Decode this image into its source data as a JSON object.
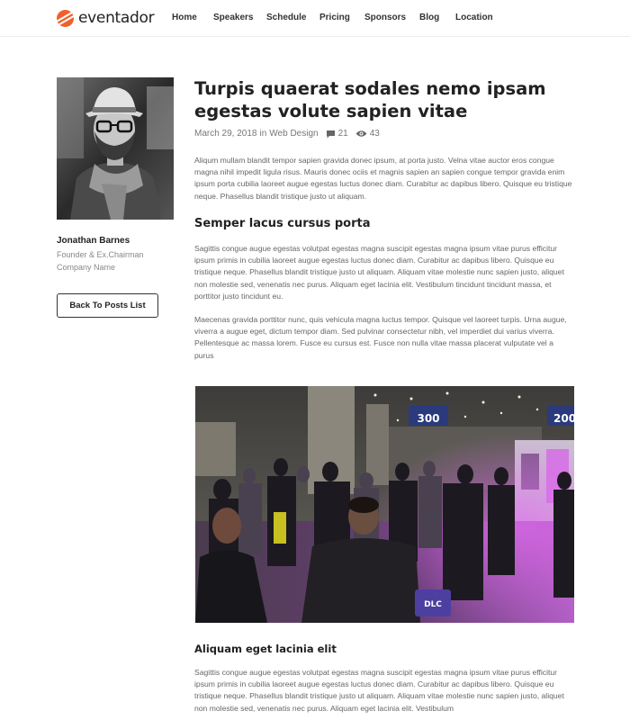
{
  "brand": {
    "name": "eventador",
    "accent": "#f0602b"
  },
  "nav": {
    "items": [
      {
        "label": "Home"
      },
      {
        "label": "Speakers"
      },
      {
        "label": "Schedule"
      },
      {
        "label": "Pricing"
      },
      {
        "label": "Sponsors"
      },
      {
        "label": "Blog"
      },
      {
        "label": "Location"
      }
    ]
  },
  "author": {
    "name": "Jonathan Barnes",
    "role": "Founder & Ex.Chairman",
    "company": "Company Name",
    "back_label": "Back To Posts List"
  },
  "post": {
    "title": "Turpis quaerat sodales nemo ipsam egestas volute sapien vitae",
    "date": "March 29, 2018",
    "in_word": "in",
    "category": "Web Design",
    "comments": "21",
    "views": "43",
    "intro": "Aliqum mullam blandit tempor sapien gravida donec ipsum, at porta justo. Velna vitae auctor eros congue magna nihil impedit ligula risus. Mauris donec ociis et magnis sapien an sapien congue tempor gravida enim ipsum porta cubilia laoreet augue egestas luctus donec diam. Curabitur ac dapibus libero. Quisque eu tristique neque. Phasellus blandit tristique justo ut aliquam.",
    "heading1": "Semper lacus cursus porta",
    "para1": "Sagittis congue augue egestas volutpat egestas magna suscipit egestas magna ipsum vitae purus efficitur ipsum primis in cubilia laoreet augue egestas luctus donec diam. Curabitur ac dapibus libero. Quisque eu tristique neque. Phasellus blandit tristique justo ut aliquam. Aliquam vitae molestie nunc sapien justo, aliquet non molestie sed, venenatis nec purus. Aliquam eget lacinia elit. Vestibulum tincidunt tincidunt massa, et porttitor justo tincidunt eu.",
    "para2": "Maecenas gravida porttitor nunc, quis vehicula magna luctus tempor. Quisque vel laoreet turpis. Urna augue, viverra a augue eget, dictum tempor diam. Sed pulvinar consectetur nibh, vel imperdiet dui varius viverra. Pellentesque ac massa lorem. Fusce eu cursus est. Fusce non nulla vitae massa placerat vulputate vel a purus",
    "photo_signs": [
      "300",
      "200"
    ],
    "photo_badge": "DLC",
    "heading2": "Aliquam eget lacinia elit",
    "para3": "Sagittis congue augue egestas volutpat egestas magna suscipit egestas magna ipsum vitae purus efficitur ipsum primis in cubilia laoreet augue egestas luctus donec diam. Curabitur ac dapibus libero. Quisque eu tristique neque. Phasellus blandit tristique justo ut aliquam. Aliquam vitae molestie nunc sapien justo, aliquet non molestie sed, venenatis nec purus. Aliquam eget lacinia elit. Vestibulum"
  }
}
